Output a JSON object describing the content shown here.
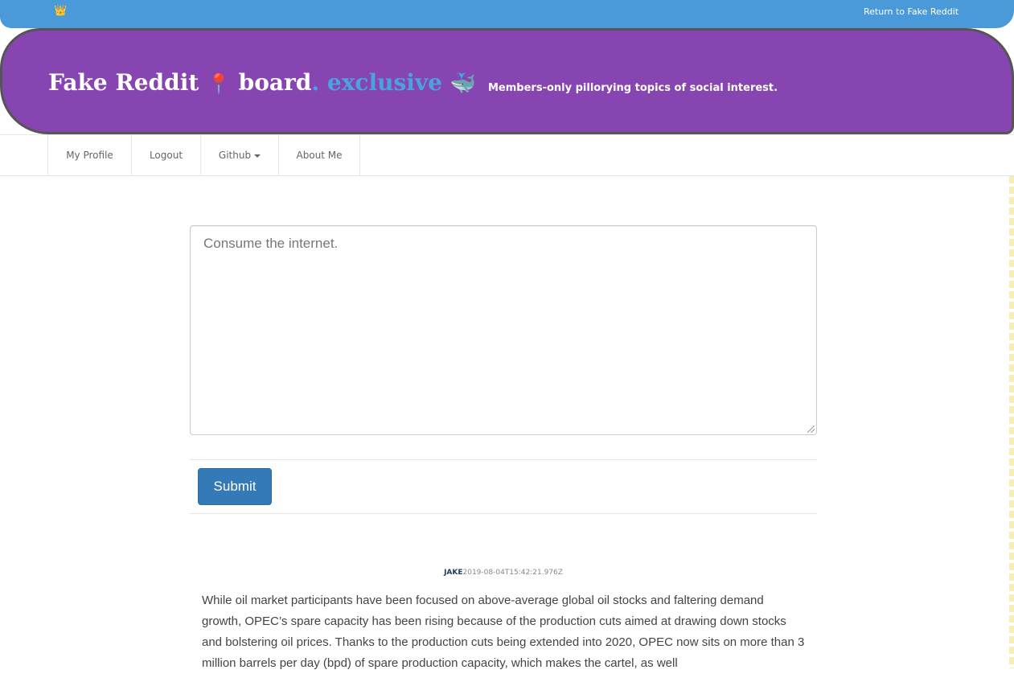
{
  "topbar": {
    "crown_icon": "crown-icon",
    "crown_glyph": "👑",
    "return_link": "Return to Fake Reddit"
  },
  "header": {
    "brand_part1": "Fake Reddit",
    "pin_glyph": "📍",
    "brand_part2": "board",
    "brand_part3": ". exclusive",
    "whale_glyph": "🐳",
    "tagline": "Members-only pillorying topics of social interest.",
    "colors": {
      "background": "#8645b0",
      "accent": "#4aa3e0"
    }
  },
  "nav": {
    "items": [
      {
        "label": "My Profile"
      },
      {
        "label": "Logout"
      },
      {
        "label": "Github",
        "has_dropdown": true
      },
      {
        "label": "About Me"
      }
    ]
  },
  "composer": {
    "placeholder": "Consume the internet.",
    "value": "",
    "submit_label": "Submit"
  },
  "post": {
    "author": "JAKE",
    "timestamp": "2019-08-04T15:42:21.976Z",
    "body": "While oil market participants have been focused on above-average global oil stocks and faltering demand growth, OPEC’s spare capacity has been rising because of the production cuts aimed at drawing down stocks and bolstering oil prices. Thanks to the production cuts being extended into 2020, OPEC now sits on more than 3 million barrels per day (bpd) of spare production capacity, which makes the cartel, as well"
  }
}
